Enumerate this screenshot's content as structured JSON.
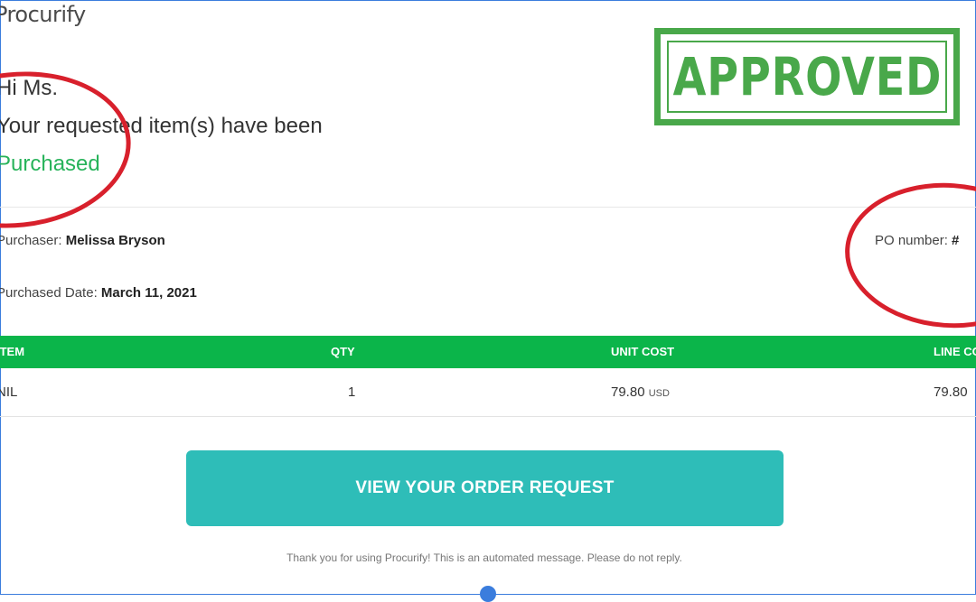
{
  "header": {
    "logo_text": "Procurify",
    "greeting": "Hi Ms.",
    "message_line": "Your requested item(s) have been",
    "status_word": "Purchased"
  },
  "stamp": {
    "text": "APPROVED",
    "color": "#49a84a"
  },
  "details": {
    "purchaser_label": "Purchaser:",
    "purchaser_name": "Melissa Bryson",
    "date_label": "Purchased Date:",
    "date_value": "March 11, 2021",
    "po_label": "PO number:",
    "po_value": "#"
  },
  "table": {
    "header_color": "#0bb54a",
    "columns": [
      "ITEM",
      "QTY",
      "UNIT COST",
      "LINE COST"
    ],
    "rows": [
      {
        "item": "NIL",
        "qty": "1",
        "unit_cost": "79.80",
        "unit_currency": "USD",
        "line_cost": "79.80"
      }
    ]
  },
  "cta": {
    "label": "VIEW YOUR ORDER REQUEST",
    "color": "#2ebdb8"
  },
  "footer": {
    "text": "Thank you for using Procurify! This is an automated message. Please do not reply."
  },
  "annotations": {
    "circle_color": "#d8202c"
  }
}
